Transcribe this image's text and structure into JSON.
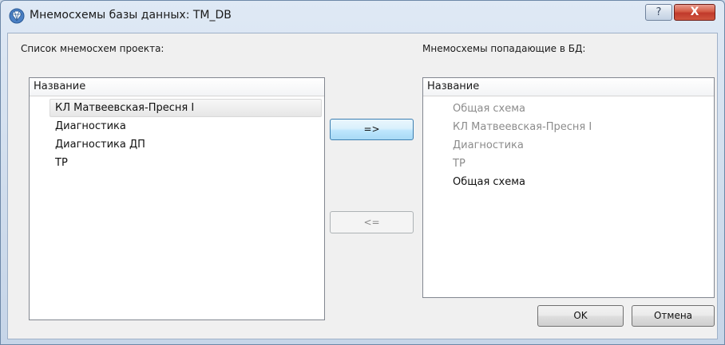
{
  "window": {
    "title": "Мнемосхемы базы данных: TM_DB",
    "help_label": "?",
    "close_label": "X"
  },
  "left_panel": {
    "label": "Список мнемосхем проекта:",
    "header": "Название",
    "items": [
      {
        "text": "КЛ Матвеевская-Пресня I",
        "selected": true
      },
      {
        "text": "Диагностика"
      },
      {
        "text": "Диагностика ДП"
      },
      {
        "text": "ТР"
      }
    ]
  },
  "right_panel": {
    "label": "Мнемосхемы попадающие в БД:",
    "header": "Название",
    "items": [
      {
        "text": "Общая схема",
        "state": "disabled"
      },
      {
        "text": "КЛ Матвеевская-Пресня I",
        "state": "disabled"
      },
      {
        "text": "Диагностика",
        "state": "disabled"
      },
      {
        "text": "ТР",
        "state": "disabled"
      },
      {
        "text": "Общая схема",
        "state": "enabled"
      }
    ]
  },
  "buttons": {
    "add": "=>",
    "remove": "<=",
    "ok": "OK",
    "cancel": "Отмена"
  },
  "colors": {
    "accent": "#3c7fb1",
    "disabled_text": "#8c8c8c",
    "close": "#c0392b"
  }
}
